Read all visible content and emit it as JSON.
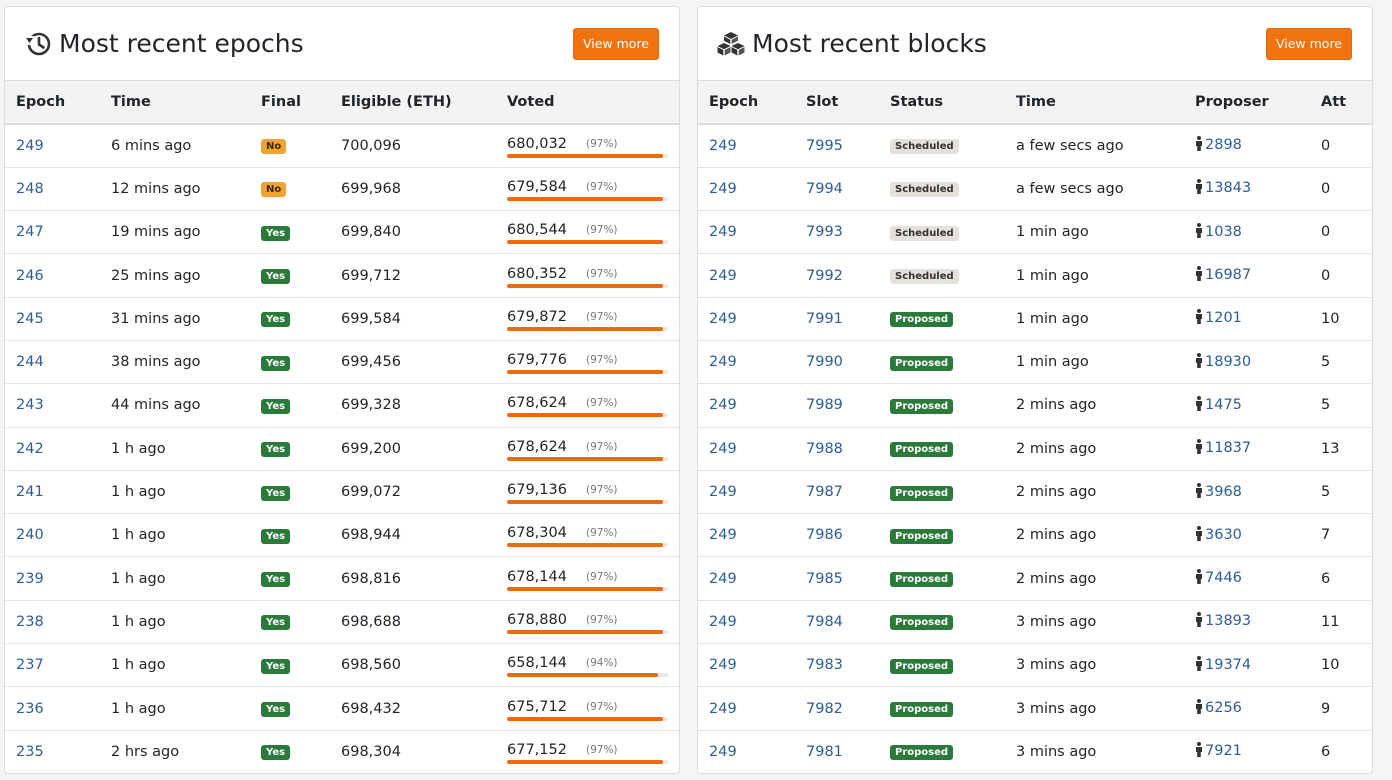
{
  "epochs_card": {
    "title": "Most recent epochs",
    "icon": "history-icon",
    "view_more": "View more",
    "columns": [
      "Epoch",
      "Time",
      "Final",
      "Eligible (ETH)",
      "Voted"
    ],
    "rows": [
      {
        "epoch": "249",
        "time": "6 mins ago",
        "final": "No",
        "eligible": "700,096",
        "voted": "680,032",
        "pct": "(97%)",
        "fraction": 0.97
      },
      {
        "epoch": "248",
        "time": "12 mins ago",
        "final": "No",
        "eligible": "699,968",
        "voted": "679,584",
        "pct": "(97%)",
        "fraction": 0.97
      },
      {
        "epoch": "247",
        "time": "19 mins ago",
        "final": "Yes",
        "eligible": "699,840",
        "voted": "680,544",
        "pct": "(97%)",
        "fraction": 0.97
      },
      {
        "epoch": "246",
        "time": "25 mins ago",
        "final": "Yes",
        "eligible": "699,712",
        "voted": "680,352",
        "pct": "(97%)",
        "fraction": 0.97
      },
      {
        "epoch": "245",
        "time": "31 mins ago",
        "final": "Yes",
        "eligible": "699,584",
        "voted": "679,872",
        "pct": "(97%)",
        "fraction": 0.97
      },
      {
        "epoch": "244",
        "time": "38 mins ago",
        "final": "Yes",
        "eligible": "699,456",
        "voted": "679,776",
        "pct": "(97%)",
        "fraction": 0.97
      },
      {
        "epoch": "243",
        "time": "44 mins ago",
        "final": "Yes",
        "eligible": "699,328",
        "voted": "678,624",
        "pct": "(97%)",
        "fraction": 0.97
      },
      {
        "epoch": "242",
        "time": "1 h ago",
        "final": "Yes",
        "eligible": "699,200",
        "voted": "678,624",
        "pct": "(97%)",
        "fraction": 0.97
      },
      {
        "epoch": "241",
        "time": "1 h ago",
        "final": "Yes",
        "eligible": "699,072",
        "voted": "679,136",
        "pct": "(97%)",
        "fraction": 0.97
      },
      {
        "epoch": "240",
        "time": "1 h ago",
        "final": "Yes",
        "eligible": "698,944",
        "voted": "678,304",
        "pct": "(97%)",
        "fraction": 0.97
      },
      {
        "epoch": "239",
        "time": "1 h ago",
        "final": "Yes",
        "eligible": "698,816",
        "voted": "678,144",
        "pct": "(97%)",
        "fraction": 0.97
      },
      {
        "epoch": "238",
        "time": "1 h ago",
        "final": "Yes",
        "eligible": "698,688",
        "voted": "678,880",
        "pct": "(97%)",
        "fraction": 0.97
      },
      {
        "epoch": "237",
        "time": "1 h ago",
        "final": "Yes",
        "eligible": "698,560",
        "voted": "658,144",
        "pct": "(94%)",
        "fraction": 0.94
      },
      {
        "epoch": "236",
        "time": "1 h ago",
        "final": "Yes",
        "eligible": "698,432",
        "voted": "675,712",
        "pct": "(97%)",
        "fraction": 0.97
      },
      {
        "epoch": "235",
        "time": "2 hrs ago",
        "final": "Yes",
        "eligible": "698,304",
        "voted": "677,152",
        "pct": "(97%)",
        "fraction": 0.97
      }
    ]
  },
  "blocks_card": {
    "title": "Most recent blocks",
    "icon": "cubes-icon",
    "view_more": "View more",
    "columns": [
      "Epoch",
      "Slot",
      "Status",
      "Time",
      "Proposer",
      "Att"
    ],
    "rows": [
      {
        "epoch": "249",
        "slot": "7995",
        "status": "Scheduled",
        "time": "a few secs ago",
        "proposer": "2898",
        "att": "0"
      },
      {
        "epoch": "249",
        "slot": "7994",
        "status": "Scheduled",
        "time": "a few secs ago",
        "proposer": "13843",
        "att": "0"
      },
      {
        "epoch": "249",
        "slot": "7993",
        "status": "Scheduled",
        "time": "1 min ago",
        "proposer": "1038",
        "att": "0"
      },
      {
        "epoch": "249",
        "slot": "7992",
        "status": "Scheduled",
        "time": "1 min ago",
        "proposer": "16987",
        "att": "0"
      },
      {
        "epoch": "249",
        "slot": "7991",
        "status": "Proposed",
        "time": "1 min ago",
        "proposer": "1201",
        "att": "10"
      },
      {
        "epoch": "249",
        "slot": "7990",
        "status": "Proposed",
        "time": "1 min ago",
        "proposer": "18930",
        "att": "5"
      },
      {
        "epoch": "249",
        "slot": "7989",
        "status": "Proposed",
        "time": "2 mins ago",
        "proposer": "1475",
        "att": "5"
      },
      {
        "epoch": "249",
        "slot": "7988",
        "status": "Proposed",
        "time": "2 mins ago",
        "proposer": "11837",
        "att": "13"
      },
      {
        "epoch": "249",
        "slot": "7987",
        "status": "Proposed",
        "time": "2 mins ago",
        "proposer": "3968",
        "att": "5"
      },
      {
        "epoch": "249",
        "slot": "7986",
        "status": "Proposed",
        "time": "2 mins ago",
        "proposer": "3630",
        "att": "7"
      },
      {
        "epoch": "249",
        "slot": "7985",
        "status": "Proposed",
        "time": "2 mins ago",
        "proposer": "7446",
        "att": "6"
      },
      {
        "epoch": "249",
        "slot": "7984",
        "status": "Proposed",
        "time": "3 mins ago",
        "proposer": "13893",
        "att": "11"
      },
      {
        "epoch": "249",
        "slot": "7983",
        "status": "Proposed",
        "time": "3 mins ago",
        "proposer": "19374",
        "att": "10"
      },
      {
        "epoch": "249",
        "slot": "7982",
        "status": "Proposed",
        "time": "3 mins ago",
        "proposer": "6256",
        "att": "9"
      },
      {
        "epoch": "249",
        "slot": "7981",
        "status": "Proposed",
        "time": "3 mins ago",
        "proposer": "7921",
        "att": "6"
      }
    ]
  },
  "colors": {
    "accent": "#f0730f",
    "link": "#2c5c99",
    "badge_yes": "#2a7a3a",
    "badge_no": "#f0a332",
    "badge_scheduled": "#e4e0dc",
    "bar": "#ec6a0c"
  }
}
